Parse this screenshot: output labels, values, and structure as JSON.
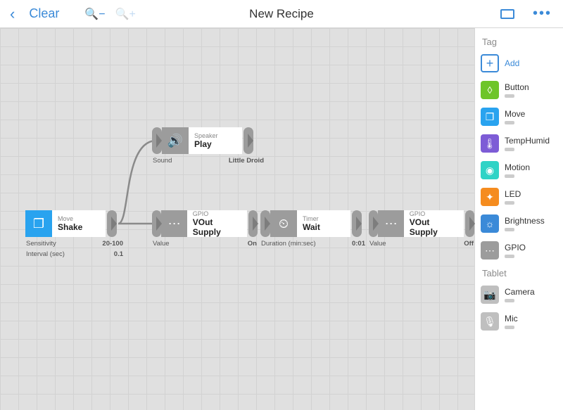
{
  "toolbar": {
    "clear": "Clear",
    "title": "New Recipe"
  },
  "sidebar": {
    "headTag": "Tag",
    "addLabel": "Add",
    "tags": [
      {
        "label": "Button",
        "color": "#6ec52a",
        "glyph": "◊"
      },
      {
        "label": "Move",
        "color": "#29a3ef",
        "glyph": "❐"
      },
      {
        "label": "TempHumid",
        "color": "#7d5cd6",
        "glyph": "🌡"
      },
      {
        "label": "Motion",
        "color": "#2fd3c6",
        "glyph": "◉"
      },
      {
        "label": "LED",
        "color": "#f58c1f",
        "glyph": "✦"
      },
      {
        "label": "Brightness",
        "color": "#3b8ad8",
        "glyph": "☼"
      },
      {
        "label": "GPIO",
        "color": "#9c9c9c",
        "glyph": "⋯"
      }
    ],
    "headTablet": "Tablet",
    "tablet": [
      {
        "label": "Camera",
        "color": "#bfbfbf",
        "glyph": "📷"
      },
      {
        "label": "Mic",
        "color": "#bfbfbf",
        "glyph": "🎙"
      }
    ]
  },
  "nodes": {
    "shake": {
      "type": "Move",
      "name": "Shake",
      "params": [
        {
          "label": "Sensitivity",
          "value": "20-100"
        },
        {
          "label": "Interval (sec)",
          "value": "0.1"
        }
      ]
    },
    "play": {
      "type": "Speaker",
      "name": "Play",
      "params": [
        {
          "label": "Sound",
          "value": "Little Droid"
        }
      ]
    },
    "gpio1": {
      "type": "GPIO",
      "name": "VOut Supply",
      "params": [
        {
          "label": "Value",
          "value": "On"
        }
      ]
    },
    "wait": {
      "type": "Timer",
      "name": "Wait",
      "params": [
        {
          "label": "Duration (min:sec)",
          "value": "0:01"
        }
      ]
    },
    "gpio2": {
      "type": "GPIO",
      "name": "VOut Supply",
      "params": [
        {
          "label": "Value",
          "value": "Off"
        }
      ]
    }
  }
}
